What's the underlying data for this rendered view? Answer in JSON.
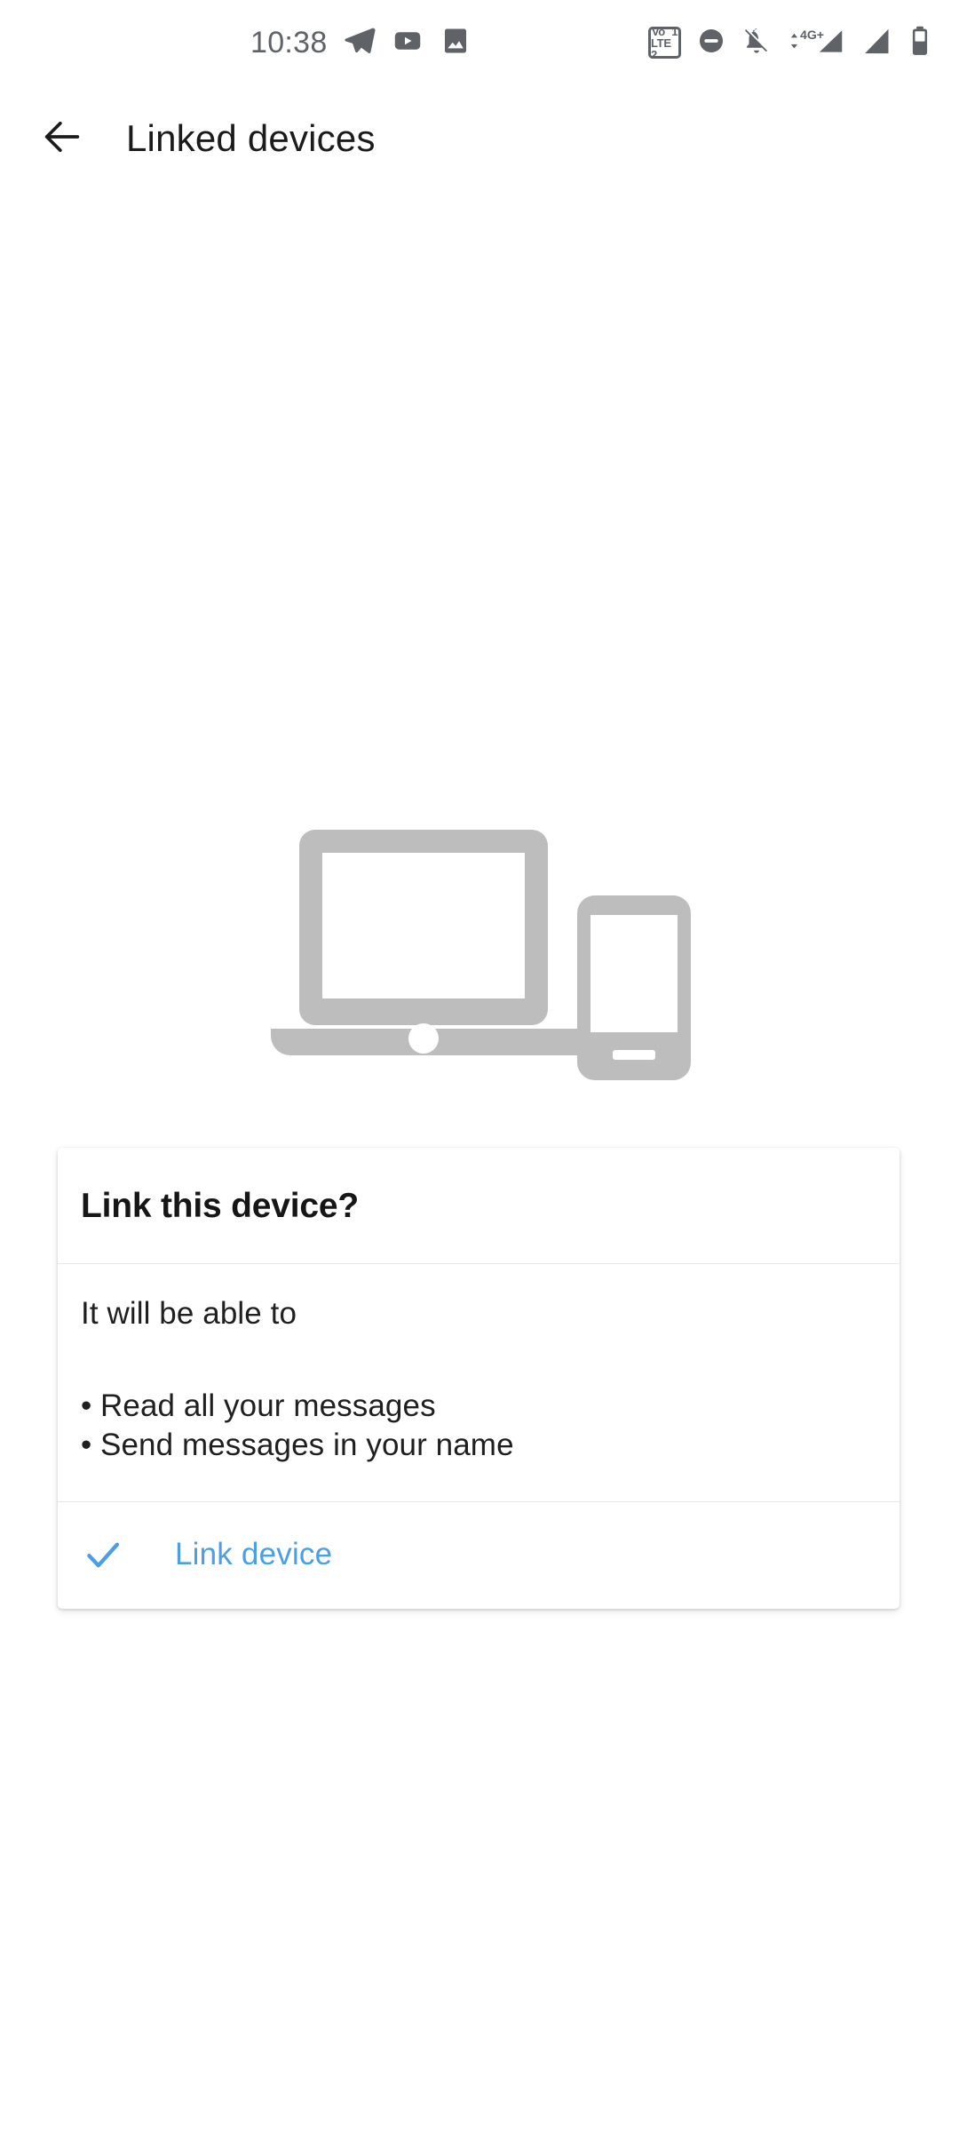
{
  "status_bar": {
    "clock": "10:38",
    "left_icons": [
      {
        "name": "telegram-icon",
        "glyph": "paper-plane"
      },
      {
        "name": "youtube-icon",
        "glyph": "play-in-rounded-rect"
      },
      {
        "name": "gallery-icon",
        "glyph": "photo-mountain"
      }
    ],
    "right_icons": [
      {
        "name": "volte-sim-icon",
        "line1": "Vo’’ 1",
        "line2": "LTE 2"
      },
      {
        "name": "do-not-disturb-icon",
        "glyph": "minus-circle"
      },
      {
        "name": "ringer-silent-icon",
        "glyph": "bell-slash"
      },
      {
        "name": "mobile-data-4g-plus-icon",
        "label": "4G+"
      },
      {
        "name": "signal-bars-icon",
        "glyph": "signal-triangle"
      },
      {
        "name": "battery-icon",
        "glyph": "battery-full"
      }
    ],
    "network_label": "4G+",
    "sim1_label": "Vo´ 1",
    "sim2_label": "LTE 2"
  },
  "app_bar": {
    "title": "Linked devices",
    "back_label": "Back"
  },
  "illustration": {
    "name": "laptop-and-phone-illustration",
    "color": "#bdbdbd"
  },
  "dialog": {
    "title": "Link this device?",
    "intro": "It will be able to",
    "permissions": [
      "Read all your messages",
      "Send messages in your name"
    ],
    "bullet": "•",
    "action": {
      "label": "Link device",
      "color": "#4a9fe6",
      "icon": "check-icon"
    }
  },
  "colors": {
    "accent": "#4a9fe6",
    "illustration_gray": "#bdbdbd",
    "status_icon": "#5f6368",
    "text_primary": "#1f1f1f",
    "divider": "#e8e8e8",
    "background": "#ffffff"
  }
}
